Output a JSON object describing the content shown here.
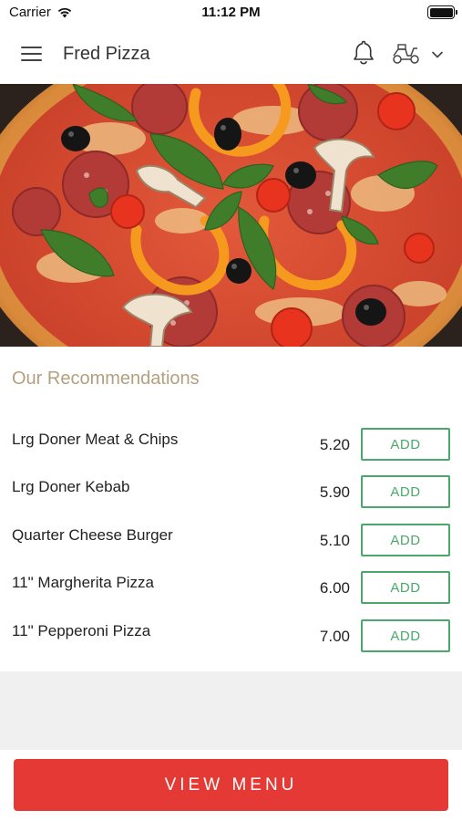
{
  "status_bar": {
    "carrier": "Carrier",
    "time": "11:12 PM"
  },
  "header": {
    "title": "Fred Pizza",
    "icons": [
      "hamburger-menu-icon",
      "bell-icon",
      "scooter-icon",
      "chevron-down-icon"
    ]
  },
  "hero": {
    "image": "pizza-photo"
  },
  "recommendations": {
    "title": "Our Recommendations",
    "add_label": "ADD",
    "items": [
      {
        "name": "Lrg Doner Meat & Chips",
        "price": "5.20",
        "button": "ADD"
      },
      {
        "name": "Lrg Doner Kebab",
        "price": "5.90",
        "button": "ADD"
      },
      {
        "name": "Quarter Cheese Burger",
        "price": "5.10",
        "button": "ADD"
      },
      {
        "name": "11\" Margherita Pizza",
        "price": "6.00",
        "button": "ADD"
      },
      {
        "name": "11\" Pepperoni Pizza",
        "price": "7.00",
        "button": "ADD"
      }
    ]
  },
  "footer": {
    "view_menu_label": "VIEW MENU"
  },
  "colors": {
    "accent_red": "#e53935",
    "add_green": "#4aa86a",
    "section_title": "#b3a07f"
  }
}
